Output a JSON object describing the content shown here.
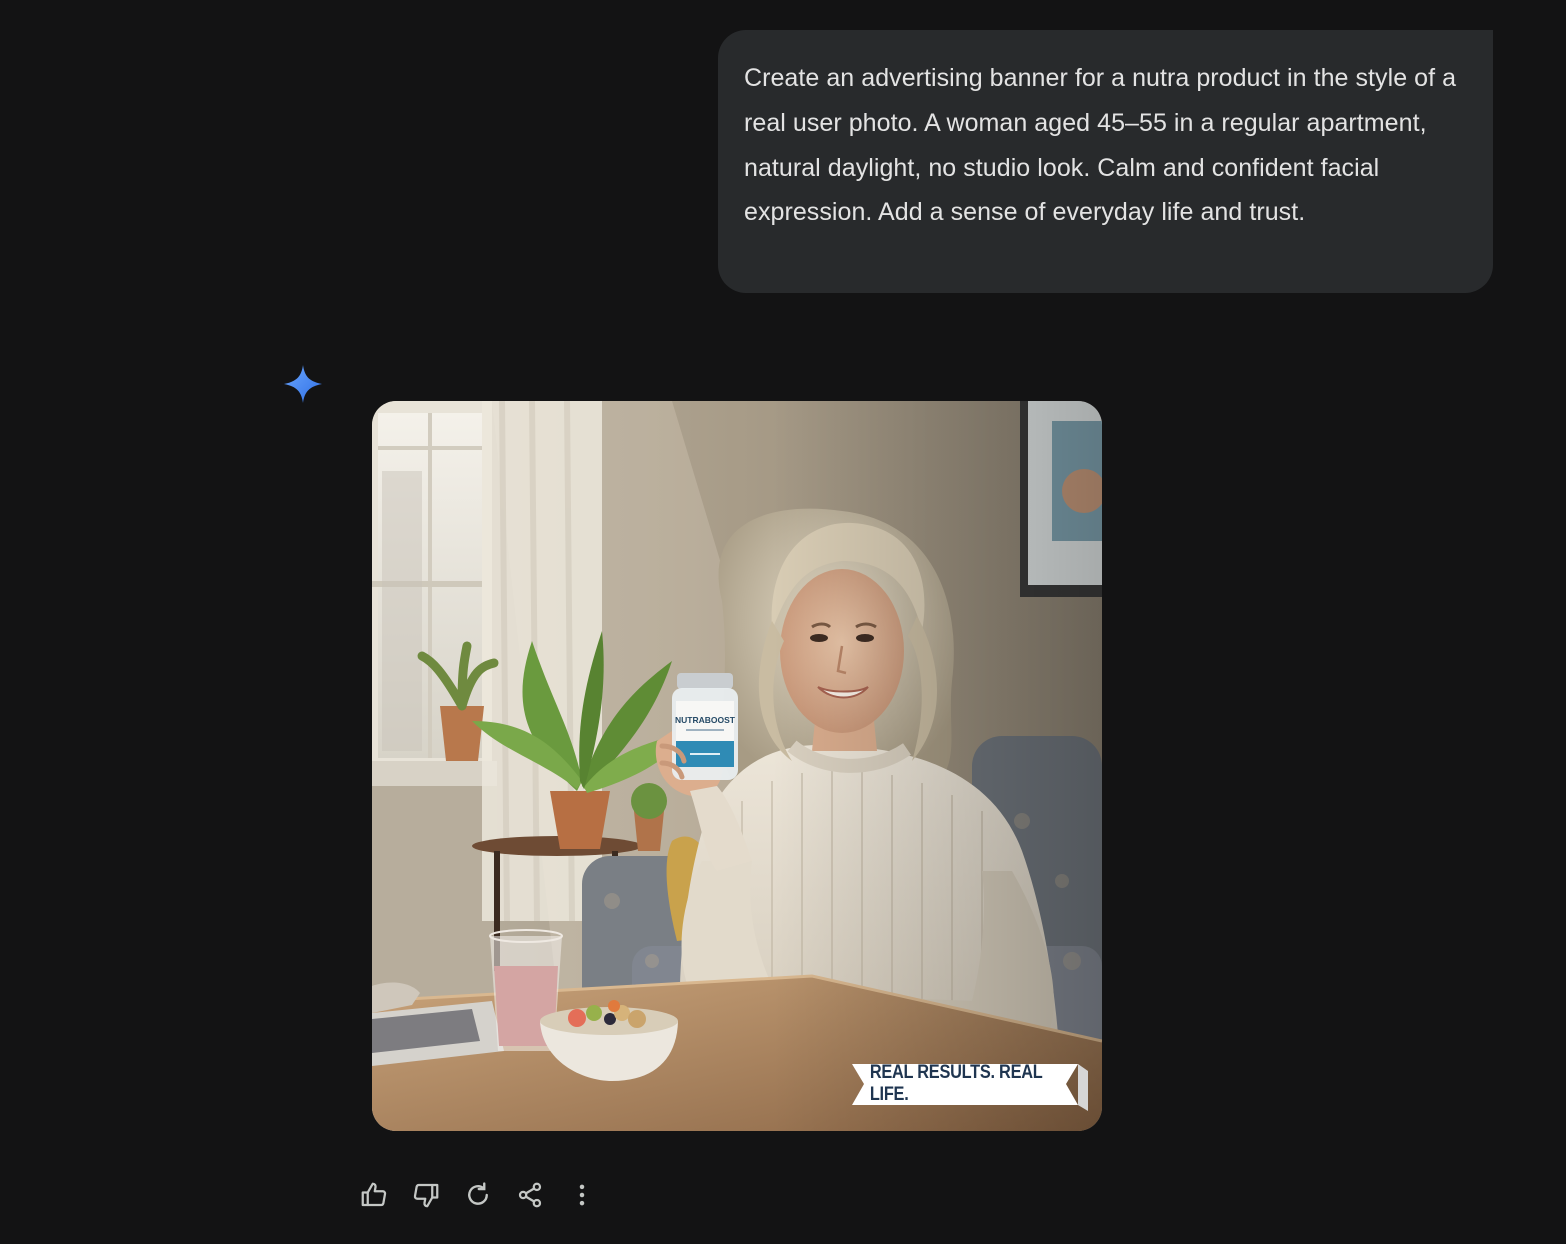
{
  "conversation": {
    "user_message": "Create an advertising banner for a nutra product in the style of a real user photo. A woman aged 45–55 in a regular apartment, natural daylight, no studio look. Calm and confident facial expression. Add a sense of everyday life and trust.",
    "response": {
      "assistant_icon": "gemini-sparkle-icon",
      "image": {
        "banner_text": "REAL RESULTS. REAL LIFE.",
        "product_label": "NUTRABOOST"
      },
      "actions": [
        {
          "name": "thumbs-up-icon"
        },
        {
          "name": "thumbs-down-icon"
        },
        {
          "name": "regenerate-icon"
        },
        {
          "name": "share-icon"
        },
        {
          "name": "more-options-icon"
        }
      ]
    }
  },
  "colors": {
    "background": "#131314",
    "bubble": "#282a2c",
    "text": "#e3e3e3",
    "icon": "#c4c7c5",
    "accent": "#4b8ef7"
  }
}
